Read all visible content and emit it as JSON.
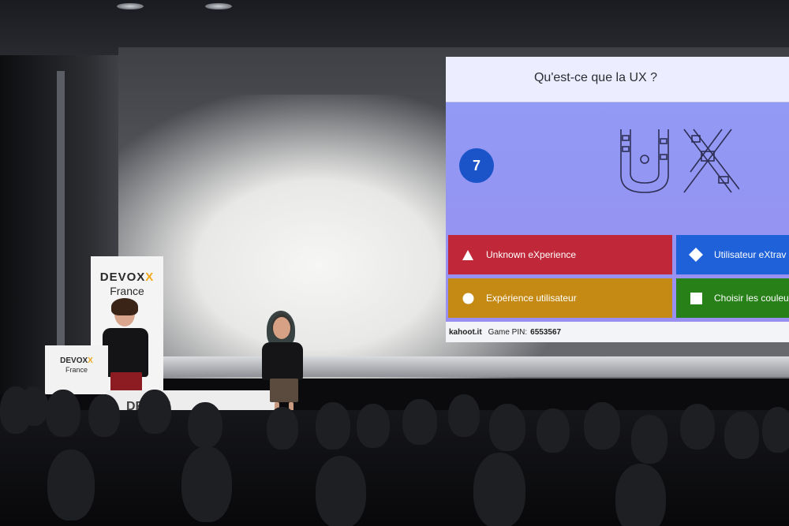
{
  "slide": {
    "title": "Qu'est-ce que la UX ?",
    "timer": "7",
    "answers": [
      {
        "shape": "triangle-icon",
        "label": "Unknown eXperience",
        "color": "#c0283a"
      },
      {
        "shape": "diamond-icon",
        "label": "Utilisateur eXtrav",
        "color": "#1f61d8"
      },
      {
        "shape": "circle-icon",
        "label": "Expérience utilisateur",
        "color": "#c48a14"
      },
      {
        "shape": "square-icon",
        "label": "Choisir les couleu",
        "color": "#288018"
      }
    ],
    "footer": {
      "brand": "kahoot.it",
      "pin_label": "Game PIN:",
      "pin_value": "6553567"
    }
  },
  "banner": {
    "brand_prefix": "DEVOX",
    "brand_x": "X",
    "subtitle": "France"
  },
  "lectern": {
    "brand_prefix": "DEVOX",
    "brand_x": "X",
    "subtitle": "France"
  },
  "table_sign": {
    "text": "DEVOX"
  }
}
